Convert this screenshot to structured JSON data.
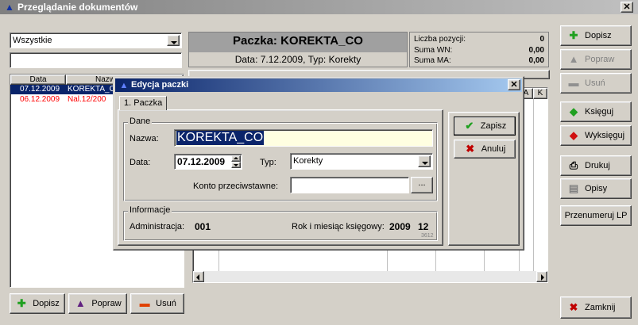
{
  "window": {
    "title": "Przeglądanie dokumentów"
  },
  "filter": {
    "selected": "Wszystkie",
    "search_value": ""
  },
  "list": {
    "headers": [
      "Data",
      "Nazwa"
    ],
    "rows": [
      {
        "date": "07.12.2009",
        "name": "KOREKTA_CO",
        "selected": true
      },
      {
        "date": "06.12.2009",
        "name": "Nal.12/200",
        "selected": false
      }
    ]
  },
  "package_header": {
    "title": "Paczka: KOREKTA_CO",
    "subtitle": "Data: 7.12.2009, Typ: Korekty"
  },
  "summary": {
    "items": [
      {
        "label": "Liczba pozycji:",
        "value": "0"
      },
      {
        "label": "Suma WN:",
        "value": "0,00"
      },
      {
        "label": "Suma MA:",
        "value": "0,00"
      }
    ]
  },
  "grid": {
    "headers": [
      "A",
      "K"
    ]
  },
  "bottom_buttons": {
    "add": "Dopisz",
    "edit": "Popraw",
    "delete": "Usuń"
  },
  "side_buttons": {
    "add": "Dopisz",
    "edit": "Popraw",
    "delete": "Usuń",
    "post": "Księguj",
    "unpost": "Wyksięguj",
    "print": "Drukuj",
    "descriptions": "Opisy",
    "renumber": "Przenumeruj LP",
    "close": "Zamknij"
  },
  "dialog": {
    "title": "Edycja paczki",
    "tab": "1. Paczka",
    "group_data": "Dane",
    "name_label": "Nazwa:",
    "name_value": "KOREKTA_CO",
    "date_label": "Data:",
    "date_value": "07.12.2009",
    "type_label": "Typ:",
    "type_value": "Korekty",
    "account_label": "Konto przeciwstawne:",
    "account_value": "",
    "browse_label": "...",
    "group_info": "Informacje",
    "admin_label": "Administracja:",
    "admin_value": "001",
    "period_label": "Rok i miesiąc księgowy:",
    "period_year": "2009",
    "period_month": "12",
    "code": "3612",
    "save": "Zapisz",
    "cancel": "Anuluj"
  },
  "colors": {
    "selection": "#0a246a",
    "red_text": "#ff0000",
    "name_field_bg": "#ffffe1"
  }
}
